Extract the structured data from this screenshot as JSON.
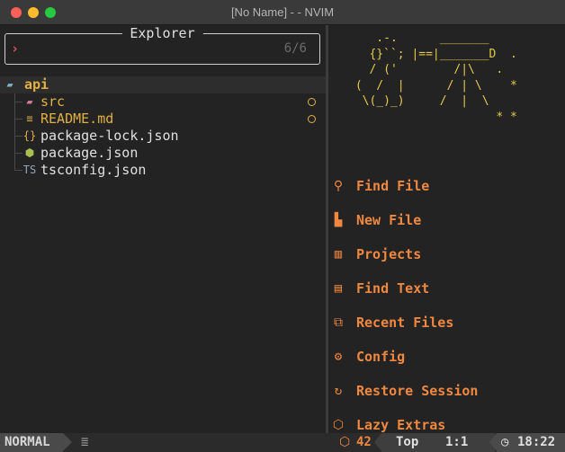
{
  "window": {
    "title": "[No Name] - - NVIM"
  },
  "explorer": {
    "title": "Explorer",
    "prompt": "›",
    "count": "6/6"
  },
  "tree": [
    {
      "name": "api",
      "icon": "folder-open-icon",
      "glyph": "▰",
      "color": "#7fb0c8",
      "label_color": "#e2b043"
    },
    {
      "name": "src",
      "icon": "folder-icon",
      "glyph": "▰",
      "color": "#d47a9a",
      "label_color": "#e2b043",
      "modified": true
    },
    {
      "name": "README.md",
      "icon": "readme-icon",
      "glyph": "≡",
      "color": "#e2b043",
      "label_color": "#e2b043",
      "modified": true
    },
    {
      "name": "package-lock.json",
      "icon": "json-icon",
      "glyph": "{}",
      "color": "#e2b043",
      "label_color": "#e0e0e0"
    },
    {
      "name": "package.json",
      "icon": "nodejs-icon",
      "glyph": "⬢",
      "color": "#a8c050",
      "label_color": "#e0e0e0"
    },
    {
      "name": "tsconfig.json",
      "icon": "typescript-icon",
      "glyph": "TS",
      "color": "#8fa8c0",
      "label_color": "#e0e0e0"
    }
  ],
  "dashboard": {
    "art": "    .-.      _______\n   {}``; |==|_______D  .\n   / ('        /|\\   .\n (  /  |      / | \\    *\n  \\(_)_)     /  |  \\\n                     * *",
    "items": [
      {
        "label": "Find File",
        "icon": "search-icon",
        "glyph": "⚲"
      },
      {
        "label": "New File",
        "icon": "new-file-icon",
        "glyph": "▙"
      },
      {
        "label": "Projects",
        "icon": "projects-icon",
        "glyph": "▥"
      },
      {
        "label": "Find Text",
        "icon": "find-text-icon",
        "glyph": "▤"
      },
      {
        "label": "Recent Files",
        "icon": "recent-files-icon",
        "glyph": "⧉"
      },
      {
        "label": "Config",
        "icon": "gear-icon",
        "glyph": "⚙"
      },
      {
        "label": "Restore Session",
        "icon": "restore-icon",
        "glyph": "↻"
      },
      {
        "label": "Lazy Extras",
        "icon": "package-icon",
        "glyph": "⬡"
      }
    ]
  },
  "statusline": {
    "mode": "NORMAL",
    "lines_icon": "lines-icon",
    "plugin_icon": "package-icon",
    "plugin_count": "42",
    "scroll": "Top",
    "position": "1:1",
    "clock_icon": "clock-icon",
    "time": "18:22"
  }
}
